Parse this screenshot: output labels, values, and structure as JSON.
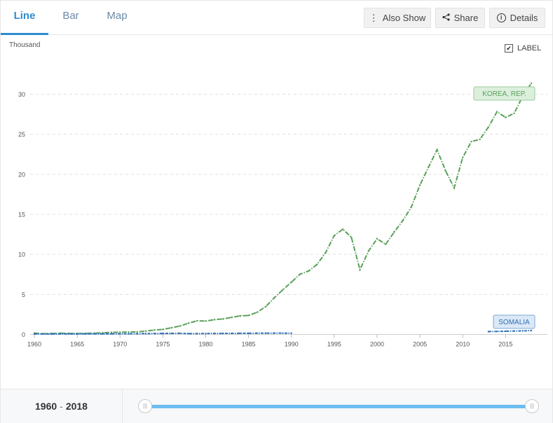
{
  "tabs": [
    {
      "label": "Line",
      "active": true
    },
    {
      "label": "Bar",
      "active": false
    },
    {
      "label": "Map",
      "active": false
    }
  ],
  "toolbar": {
    "also_show": "Also Show",
    "share": "Share",
    "details": "Details"
  },
  "label_toggle": {
    "text": "LABEL",
    "checked": true
  },
  "footer": {
    "range_start": "1960",
    "range_sep": "-",
    "range_end": "2018"
  },
  "colors": {
    "korea": "#5aa05a",
    "somalia": "#2f6fb8",
    "accent": "#2d8ccf"
  },
  "chart_data": {
    "type": "line",
    "ylabel": "Thousand",
    "xlim": [
      1960,
      2018
    ],
    "ylim": [
      0,
      32
    ],
    "yticks": [
      0,
      5,
      10,
      15,
      20,
      25,
      30
    ],
    "xticks": [
      1960,
      1965,
      1970,
      1975,
      1980,
      1985,
      1990,
      1995,
      2000,
      2005,
      2010,
      2015
    ],
    "grid": true,
    "series": [
      {
        "name": "KOREA, REP.",
        "color": "#5aa05a",
        "x": [
          1960,
          1961,
          1962,
          1963,
          1964,
          1965,
          1966,
          1967,
          1968,
          1969,
          1970,
          1971,
          1972,
          1973,
          1974,
          1975,
          1976,
          1977,
          1978,
          1979,
          1980,
          1981,
          1982,
          1983,
          1984,
          1985,
          1986,
          1987,
          1988,
          1989,
          1990,
          1991,
          1992,
          1993,
          1994,
          1995,
          1996,
          1997,
          1998,
          1999,
          2000,
          2001,
          2002,
          2003,
          2004,
          2005,
          2006,
          2007,
          2008,
          2009,
          2010,
          2011,
          2012,
          2013,
          2014,
          2015,
          2016,
          2017,
          2018
        ],
        "values": [
          0.16,
          0.09,
          0.11,
          0.15,
          0.12,
          0.11,
          0.13,
          0.16,
          0.2,
          0.25,
          0.28,
          0.3,
          0.32,
          0.41,
          0.54,
          0.62,
          0.83,
          1.05,
          1.4,
          1.7,
          1.67,
          1.84,
          1.93,
          2.12,
          2.31,
          2.37,
          2.76,
          3.46,
          4.57,
          5.57,
          6.52,
          7.52,
          7.91,
          8.74,
          10.22,
          12.33,
          13.14,
          12.13,
          8.09,
          10.4,
          11.95,
          11.25,
          12.78,
          14.21,
          15.91,
          18.64,
          20.87,
          23.06,
          20.43,
          18.29,
          22.09,
          24.08,
          24.36,
          25.89,
          27.81,
          27.1,
          27.61,
          29.74,
          31.36
        ]
      },
      {
        "name": "SOMALIA",
        "color": "#2f6fb8",
        "x": [
          1960,
          1961,
          1962,
          1963,
          1964,
          1965,
          1966,
          1967,
          1968,
          1969,
          1970,
          1971,
          1972,
          1973,
          1974,
          1975,
          1976,
          1977,
          1978,
          1979,
          1980,
          1981,
          1982,
          1983,
          1984,
          1985,
          1986,
          1987,
          1988,
          1989,
          1990,
          2013,
          2014,
          2015,
          2016,
          2017,
          2018
        ],
        "values": [
          0.06,
          0.06,
          0.06,
          0.06,
          0.06,
          0.06,
          0.07,
          0.07,
          0.07,
          0.07,
          0.08,
          0.08,
          0.09,
          0.1,
          0.11,
          0.12,
          0.13,
          0.14,
          0.1,
          0.1,
          0.11,
          0.12,
          0.12,
          0.13,
          0.14,
          0.14,
          0.15,
          0.15,
          0.16,
          0.16,
          0.15,
          0.35,
          0.37,
          0.4,
          0.42,
          0.44,
          0.48
        ]
      }
    ]
  }
}
